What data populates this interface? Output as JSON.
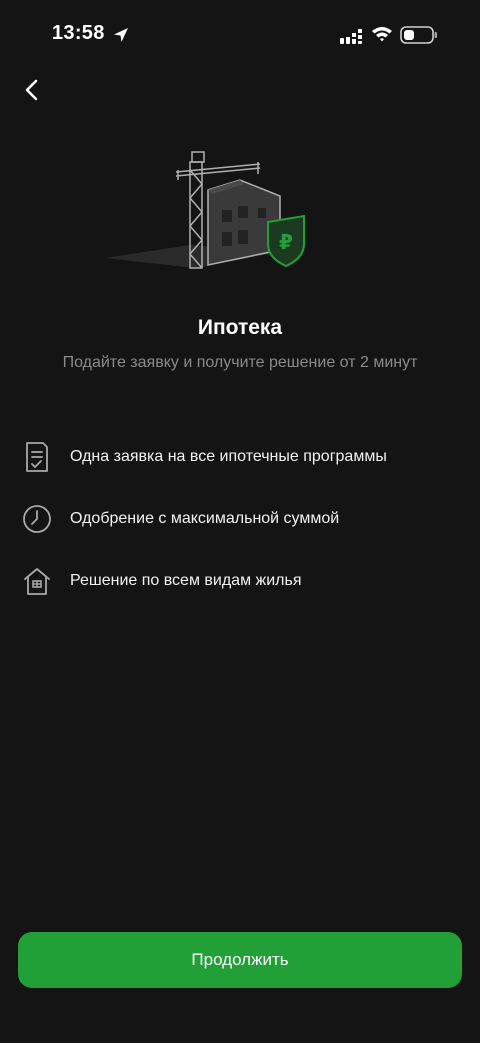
{
  "status_bar": {
    "time": "13:58"
  },
  "header": {
    "back_icon": "chevron-left-icon"
  },
  "hero": {
    "title": "Ипотека",
    "subtitle": "Подайте заявку и получите решение от 2 минут",
    "accent_color": "#21a038",
    "shield_symbol": "₽"
  },
  "features": [
    {
      "icon": "document-icon",
      "label": "Одна заявка на все ипотечные программы"
    },
    {
      "icon": "clock-icon",
      "label": "Одобрение с максимальной суммой"
    },
    {
      "icon": "house-icon",
      "label": "Решение по всем видам жилья"
    }
  ],
  "footer": {
    "continue_label": "Продолжить",
    "button_color": "#21a038"
  }
}
